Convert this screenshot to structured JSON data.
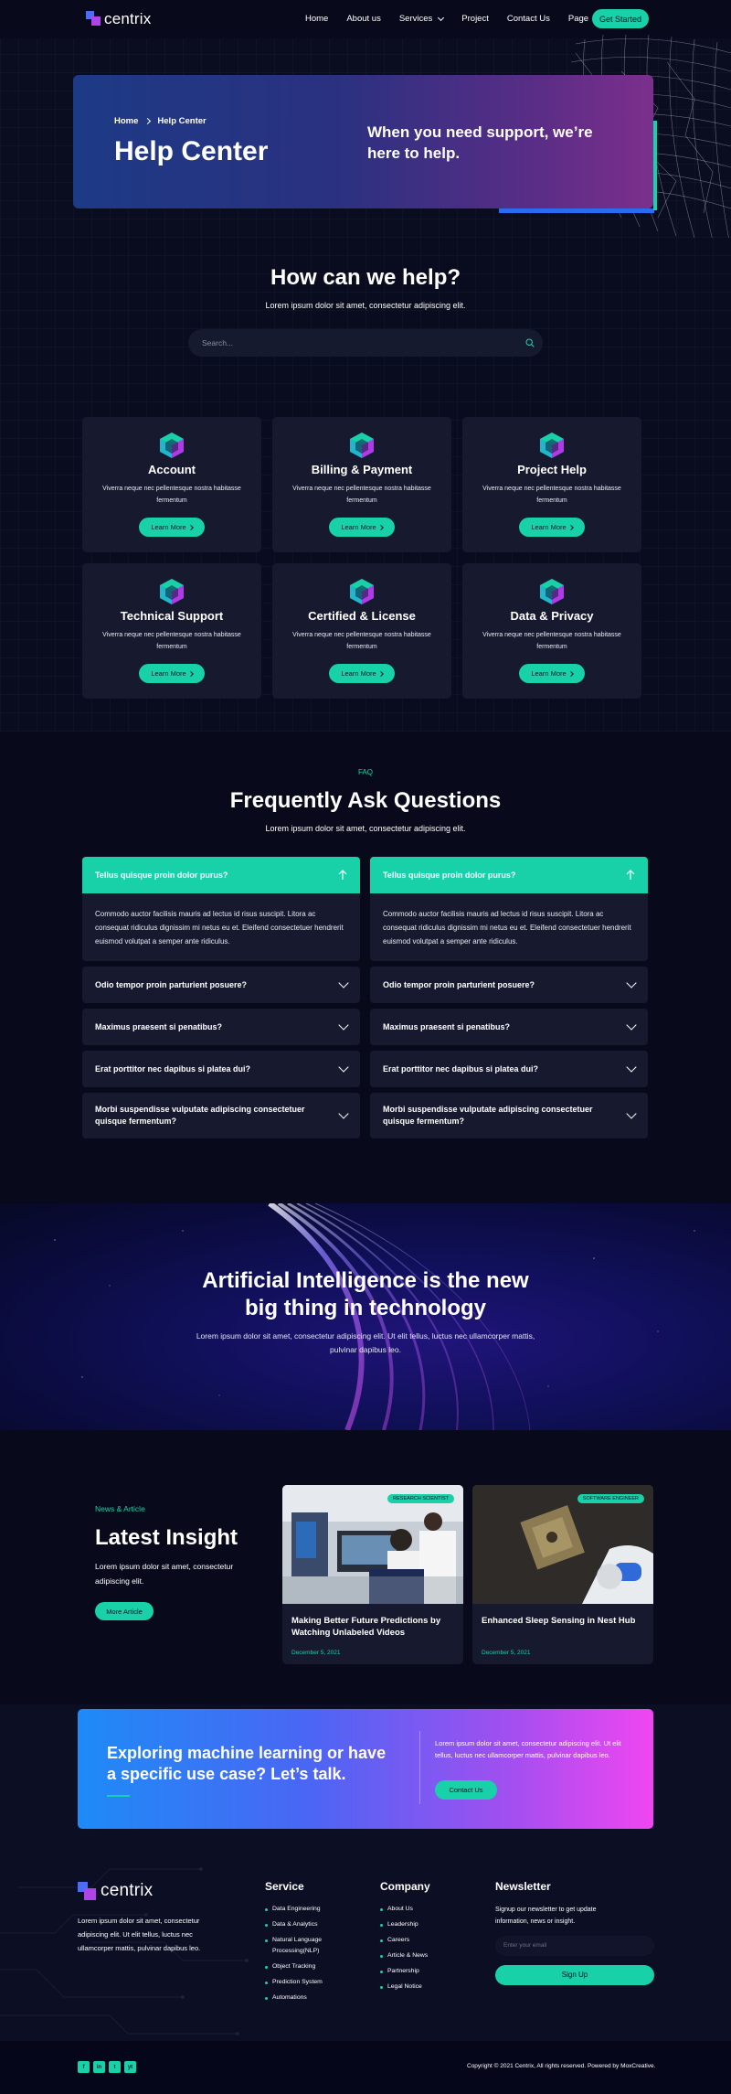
{
  "nav": {
    "logo_text": "centrix",
    "links": [
      "Home",
      "About us",
      "Services",
      "Project",
      "Contact Us",
      "Page"
    ],
    "cta": "Get Started"
  },
  "hero": {
    "breadcrumb_home": "Home",
    "breadcrumb_current": "Help Center",
    "title": "Help Center",
    "subtitle": "When you need support, we’re here to help."
  },
  "help": {
    "title": "How can we help?",
    "subtitle": "Lorem ipsum dolor sit amet, consectetur adipiscing elit.",
    "search_placeholder": "Search..."
  },
  "cards": [
    {
      "title": "Account",
      "text": "Viverra neque nec pellentesque nostra habitasse fermentum",
      "button": "Learn More",
      "icon": "cube-icon"
    },
    {
      "title": "Billing & Payment",
      "text": "Viverra neque nec pellentesque nostra habitasse fermentum",
      "button": "Learn More",
      "icon": "cube-icon"
    },
    {
      "title": "Project Help",
      "text": "Viverra neque nec pellentesque nostra habitasse fermentum",
      "button": "Learn More",
      "icon": "cube-icon"
    },
    {
      "title": "Technical Support",
      "text": "Viverra neque nec pellentesque nostra habitasse fermentum",
      "button": "Learn More",
      "icon": "cube-icon"
    },
    {
      "title": "Certified & License",
      "text": "Viverra neque nec pellentesque nostra habitasse fermentum",
      "button": "Learn More",
      "icon": "cube-icon"
    },
    {
      "title": "Data & Privacy",
      "text": "Viverra neque nec pellentesque nostra habitasse fermentum",
      "button": "Learn More",
      "icon": "cube-icon"
    }
  ],
  "faq": {
    "tag": "FAQ",
    "title": "Frequently Ask Questions",
    "subtitle": "Lorem ipsum dolor sit amet, consectetur adipiscing elit.",
    "columns": [
      {
        "open_question": "Tellus quisque proin dolor purus?",
        "open_answer": "Commodo auctor facilisis mauris ad lectus id risus suscipit. Litora ac consequat ridiculus dignissim mi netus eu et. Eleifend consectetuer hendrerit euismod volutpat a semper ante ridiculus.",
        "questions": [
          "Odio tempor proin parturient posuere?",
          "Maximus praesent si penatibus?",
          "Erat porttitor nec dapibus si platea dui?",
          "Morbi suspendisse vulputate adipiscing consectetuer quisque fermentum?"
        ]
      },
      {
        "open_question": "Tellus quisque proin dolor purus?",
        "open_answer": "Commodo auctor facilisis mauris ad lectus id risus suscipit. Litora ac consequat ridiculus dignissim mi netus eu et. Eleifend consectetuer hendrerit euismod volutpat a semper ante ridiculus.",
        "questions": [
          "Odio tempor proin parturient posuere?",
          "Maximus praesent si penatibus?",
          "Erat porttitor nec dapibus si platea dui?",
          "Morbi suspendisse vulputate adipiscing consectetuer quisque fermentum?"
        ]
      }
    ]
  },
  "ai": {
    "title": "Artificial Intelligence is the new big thing in technology",
    "subtitle": "Lorem ipsum dolor sit amet, consectetur adipiscing elit. Ut elit tellus, luctus nec ullamcorper mattis, pulvinar dapibus leo."
  },
  "insight": {
    "tag": "News & Article",
    "title": "Latest Insight",
    "subtitle": "Lorem ipsum dolor sit amet, consectetur adipiscing elit.",
    "button": "More Article",
    "posts": [
      {
        "badge": "RESEARCH SCIENTIST",
        "title": "Making Better Future Predictions by Watching Unlabeled Videos",
        "date": "December 5, 2021"
      },
      {
        "badge": "SOFTWARE ENGINEER",
        "title": "Enhanced Sleep Sensing in Nest Hub",
        "date": "December 5, 2021"
      }
    ]
  },
  "cta": {
    "title": "Exploring machine learning or have a specific use case? Let’s talk.",
    "text": "Lorem ipsum dolor sit amet, consectetur adipiscing elit. Ut elit tellus, luctus nec ullamcorper mattis, pulvinar dapibus leo.",
    "button": "Contact Us"
  },
  "footer": {
    "logo_text": "centrix",
    "about": "Lorem ipsum dolor sit amet, consectetur adipiscing elit. Ut elit tellus, luctus nec ullamcorper mattis, pulvinar dapibus leo.",
    "service_title": "Service",
    "service_items": [
      "Data Engineering",
      "Data & Analytics",
      "Natural Language Processing(NLP)",
      "Object Tracking",
      "Prediction System",
      "Automations"
    ],
    "company_title": "Company",
    "company_items": [
      "About Us",
      "Leadership",
      "Careers",
      "Article & News",
      "Partnership",
      "Legal Notice"
    ],
    "newsletter_title": "Newsletter",
    "newsletter_text": "Signup our newsletter to get update information, news or insight.",
    "email_placeholder": "Enter your email",
    "signup": "Sign Up",
    "social": [
      "f",
      "in",
      "t",
      "yt"
    ],
    "copyright": "Copyright © 2021 Centrix, All rights reserved. Powered by MoxCreative."
  },
  "colors": {
    "accent": "#18d1a8",
    "background": "#080a1c",
    "card": "#171a2e"
  }
}
